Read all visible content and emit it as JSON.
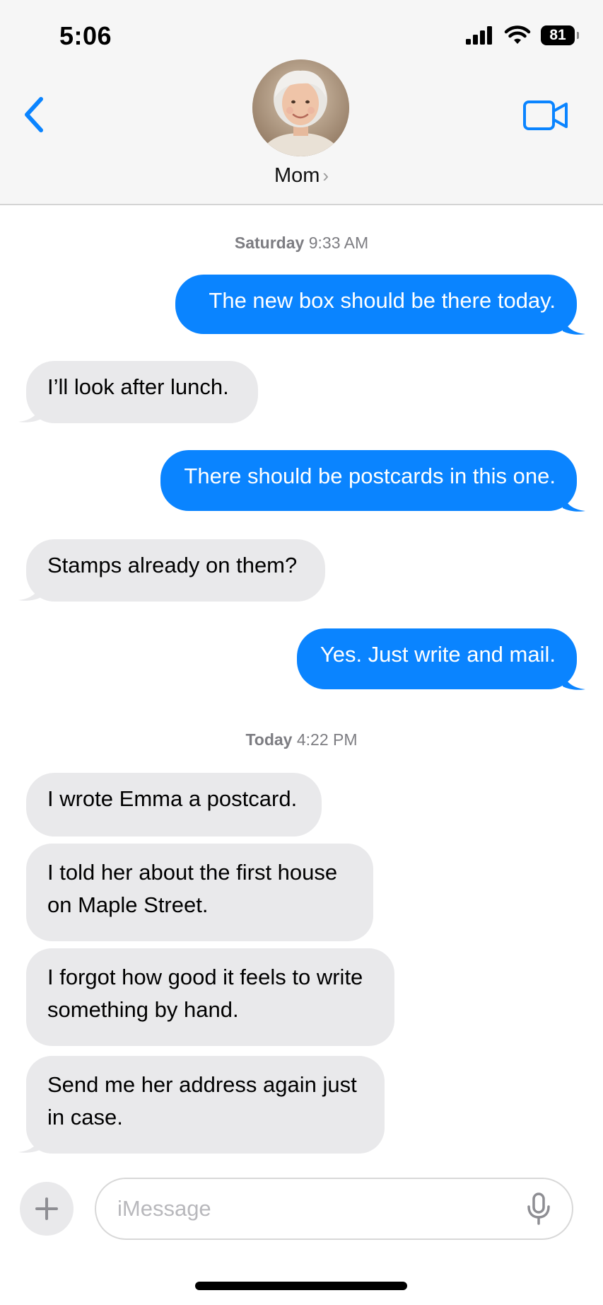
{
  "status_bar": {
    "time": "5:06",
    "battery": "81"
  },
  "header": {
    "contact_name": "Mom",
    "chevron": "›",
    "back_icon": "chevron-left-icon",
    "video_icon": "video-camera-icon",
    "accent_color": "#0a84ff"
  },
  "thread": {
    "timestamp_1": {
      "day": "Saturday",
      "time": "9:33 AM"
    },
    "messages_1": [
      {
        "direction": "outgoing",
        "text": "The new box should be there today."
      },
      {
        "direction": "incoming",
        "text": "I’ll look after lunch."
      },
      {
        "direction": "outgoing",
        "text": "There should be postcards in this one."
      },
      {
        "direction": "incoming",
        "text": "Stamps already on them?"
      },
      {
        "direction": "outgoing",
        "text": "Yes. Just write and mail."
      }
    ],
    "timestamp_2": {
      "day": "Today",
      "time": "4:22 PM"
    },
    "messages_2": [
      {
        "direction": "incoming",
        "text": "I wrote Emma a postcard."
      },
      {
        "direction": "incoming",
        "text": "I told her about the first house on Maple Street."
      },
      {
        "direction": "incoming",
        "text": "I forgot how good it feels to write something by hand."
      },
      {
        "direction": "incoming",
        "text": "Send me her address again just in case."
      }
    ],
    "outgoing_color": "#0a84ff",
    "incoming_color": "#e9e9eb"
  },
  "composer": {
    "placeholder": "iMessage",
    "plus_icon": "plus-icon",
    "mic_icon": "microphone-icon"
  }
}
